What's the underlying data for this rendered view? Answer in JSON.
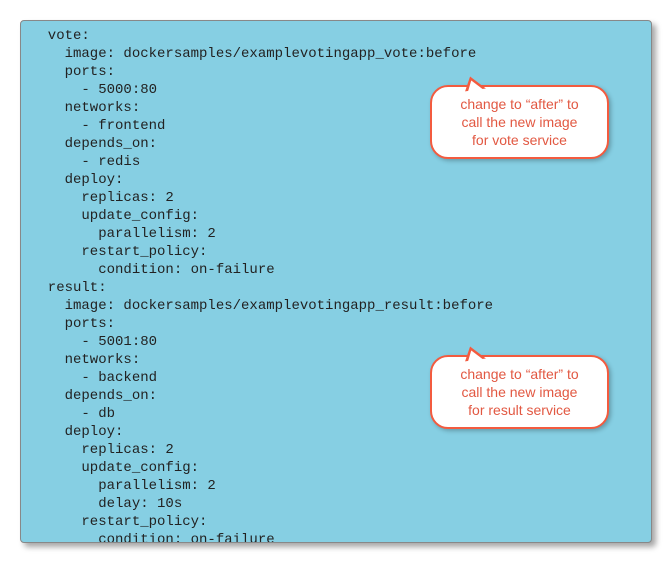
{
  "code": {
    "lines": [
      "  vote:",
      "    image: dockersamples/examplevotingapp_vote:before",
      "    ports:",
      "      - 5000:80",
      "    networks:",
      "      - frontend",
      "    depends_on:",
      "      - redis",
      "    deploy:",
      "      replicas: 2",
      "      update_config:",
      "        parallelism: 2",
      "      restart_policy:",
      "        condition: on-failure",
      "  result:",
      "    image: dockersamples/examplevotingapp_result:before",
      "    ports:",
      "      - 5001:80",
      "    networks:",
      "      - backend",
      "    depends_on:",
      "      - db",
      "    deploy:",
      "      replicas: 2",
      "      update_config:",
      "        parallelism: 2",
      "        delay: 10s",
      "      restart_policy:",
      "        condition: on-failure"
    ]
  },
  "callouts": {
    "c1": {
      "line1": "change to “after” to",
      "line2": "call the new image",
      "line3": "for vote service"
    },
    "c2": {
      "line1": "change to “after” to",
      "line2": "call the new image",
      "line3": "for result service"
    }
  }
}
